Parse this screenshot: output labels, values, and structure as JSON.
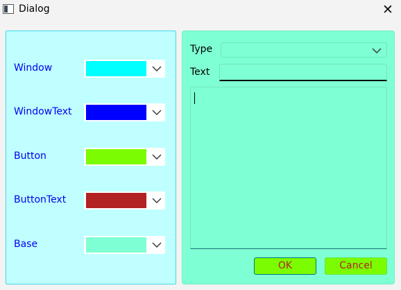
{
  "window": {
    "title": "Dialog",
    "close_glyph": "✕"
  },
  "palette": {
    "rows": [
      {
        "label": "Window",
        "color": "#00ffff"
      },
      {
        "label": "WindowText",
        "color": "#0000ff"
      },
      {
        "label": "Button",
        "color": "#7cfc00"
      },
      {
        "label": "ButtonText",
        "color": "#b22222"
      },
      {
        "label": "Base",
        "color": "#7fffd4"
      }
    ]
  },
  "form": {
    "type_label": "Type",
    "type_value": "",
    "text_label": "Text",
    "text_value": "",
    "body_value": "",
    "ok_label": "OK",
    "cancel_label": "Cancel"
  },
  "colors": {
    "panel_left_bg": "#bfffff",
    "panel_right_bg": "#7fffd4",
    "label_color": "#0000ee",
    "button_bg": "#7cfc00",
    "button_text": "#b22222"
  }
}
